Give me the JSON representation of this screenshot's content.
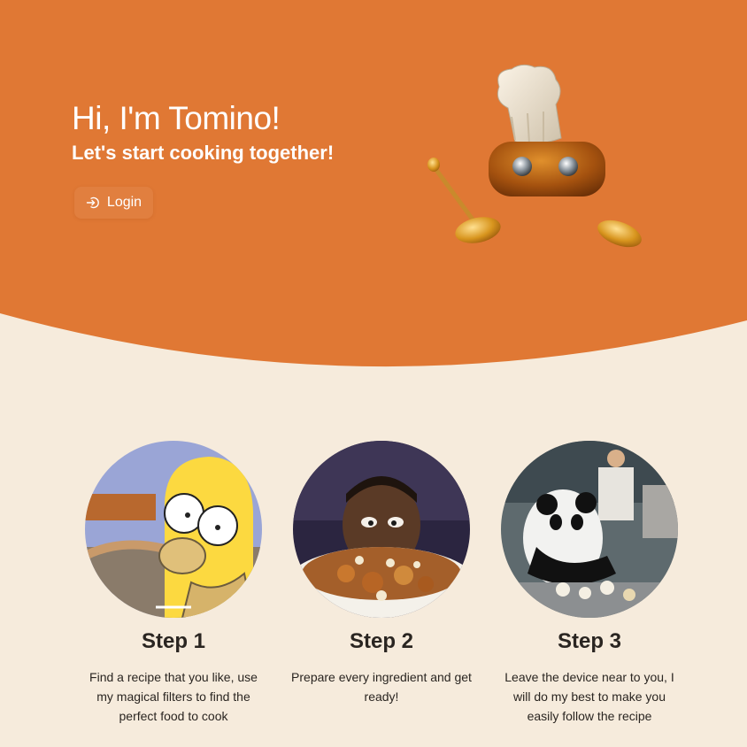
{
  "hero": {
    "title": "Hi, I'm Tomino!",
    "subtitle": "Let's start cooking together!",
    "login_label": "Login",
    "login_icon": "login-icon",
    "mascot": "chef-robot-mascot"
  },
  "steps": [
    {
      "title": "Step 1",
      "description": "Find a recipe that you like, use my magical filters to find the perfect food to cook",
      "image": "homer-simpson-drooling"
    },
    {
      "title": "Step 2",
      "description": "Prepare every ingredient and get ready!",
      "image": "man-looking-at-food-plate"
    },
    {
      "title": "Step 3",
      "description": "Leave the device near to you, I will do my best to make you easily follow the recipe",
      "image": "panda-cooking-in-kitchen"
    }
  ],
  "colors": {
    "hero_orange": "#e07834",
    "background_cream": "#f6ebdc",
    "text_dark": "#2a2521"
  }
}
